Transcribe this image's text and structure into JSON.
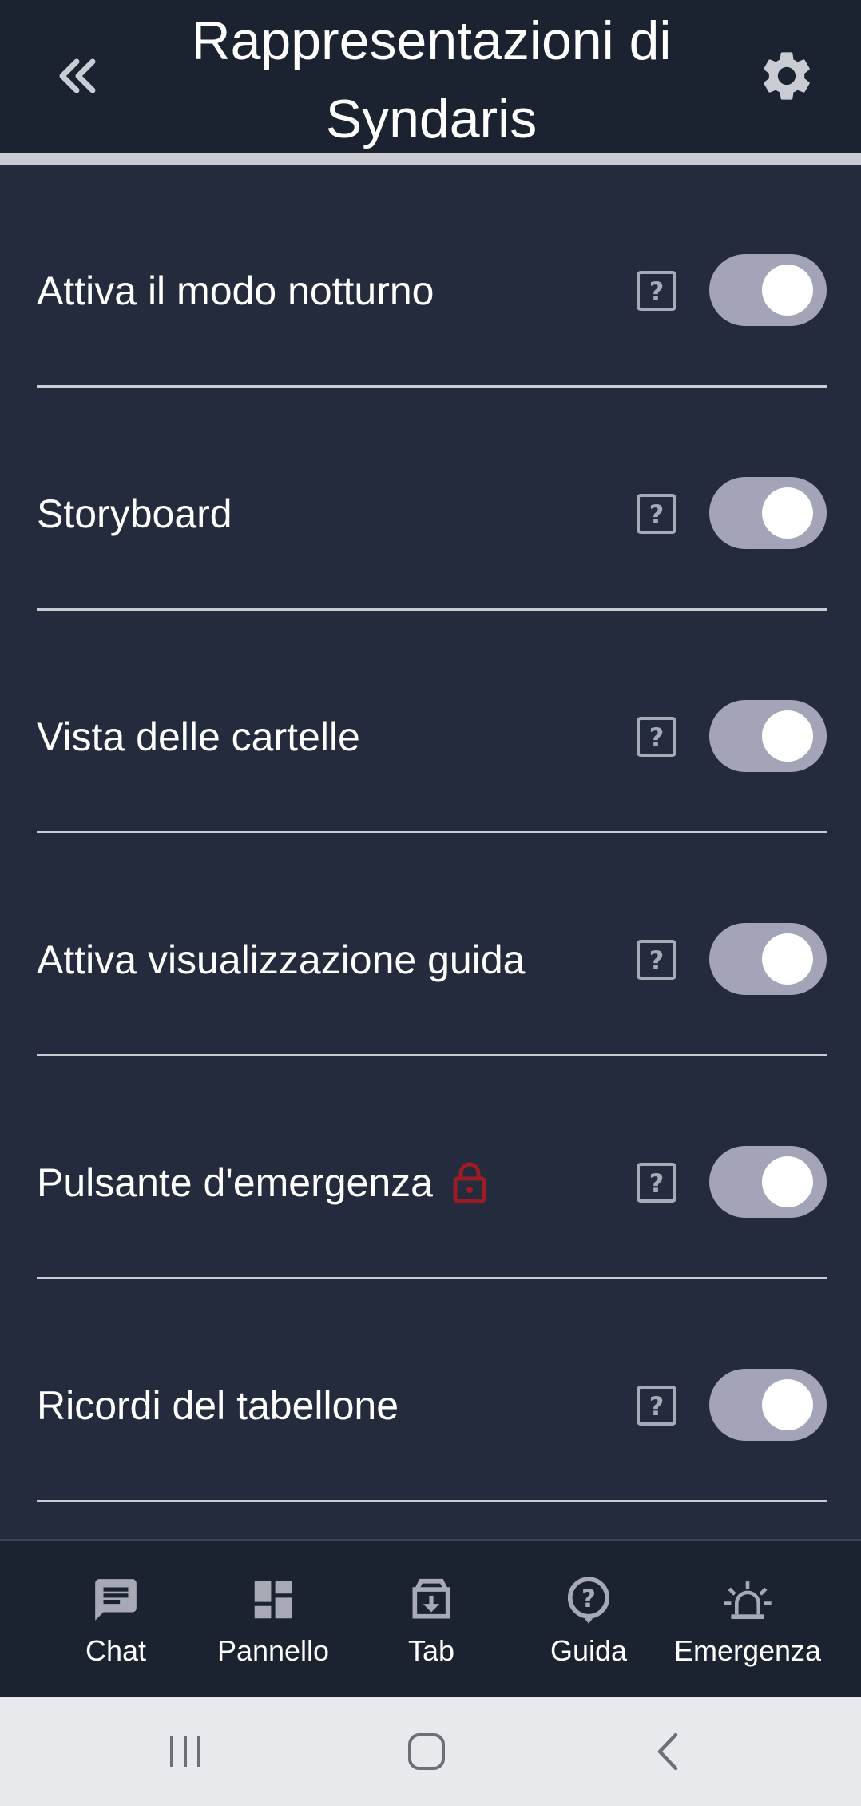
{
  "header": {
    "title": "Rappresentazioni di Syndaris",
    "back_icon": "double-chevron-left-icon",
    "settings_icon": "gear-icon"
  },
  "settings": [
    {
      "label": "Attiva il modo notturno",
      "enabled": true,
      "locked": false
    },
    {
      "label": "Storyboard",
      "enabled": true,
      "locked": false
    },
    {
      "label": "Vista delle cartelle",
      "enabled": true,
      "locked": false
    },
    {
      "label": "Attiva visualizzazione guida",
      "enabled": true,
      "locked": false
    },
    {
      "label": "Pulsante d'emergenza",
      "enabled": true,
      "locked": true
    },
    {
      "label": "Ricordi del tabellone",
      "enabled": true,
      "locked": false
    }
  ],
  "bottom_nav": [
    {
      "label": "Chat",
      "icon": "chat-icon"
    },
    {
      "label": "Pannello",
      "icon": "dashboard-icon"
    },
    {
      "label": "Tab",
      "icon": "archive-download-icon"
    },
    {
      "label": "Guida",
      "icon": "help-circle-icon"
    },
    {
      "label": "Emergenza",
      "icon": "alarm-light-icon"
    }
  ],
  "colors": {
    "background": "#232b3c",
    "header": "#1b2230",
    "divider": "#c9ccd3",
    "toggle_track": "#a3a4b8",
    "lock": "#9b1c24",
    "icon_gray": "#a7a9b5",
    "system_bar": "#e8e9ed"
  }
}
